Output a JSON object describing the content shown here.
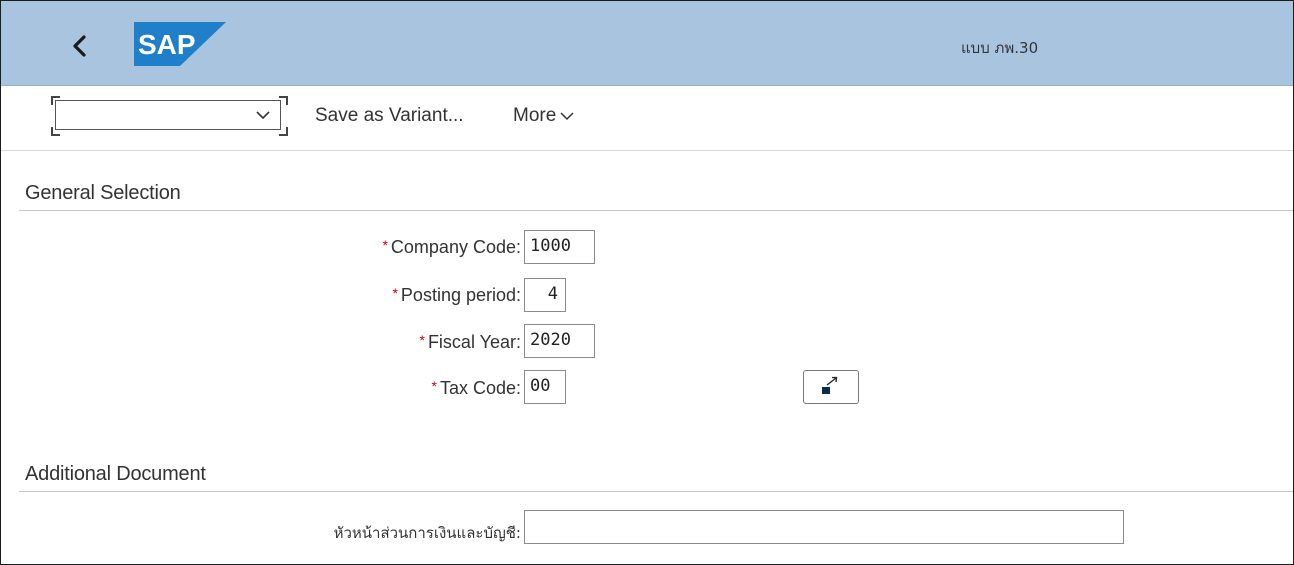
{
  "shell": {
    "title": "แบบ ภพ.30",
    "logo_text": "SAP",
    "back_icon": "chevron-left-icon",
    "colors": {
      "shellbar": "#a9c4df",
      "logo_blue": "#1f7fc9"
    }
  },
  "toolbar": {
    "variant_value": "",
    "save_variant_label": "Save as Variant...",
    "more_label": "More"
  },
  "general_selection": {
    "title": "General Selection",
    "fields": {
      "company_code": {
        "label": "Company Code:",
        "value": "1000",
        "required": "*"
      },
      "posting_period": {
        "label": "Posting period:",
        "value": "4",
        "required": "*"
      },
      "fiscal_year": {
        "label": "Fiscal Year:",
        "value": "2020",
        "required": "*"
      },
      "tax_code": {
        "label": "Tax Code:",
        "value": "00",
        "required": "*"
      }
    },
    "multiple_selection_icon": "multiple-selection-arrow-icon"
  },
  "additional_document": {
    "title": "Additional Document",
    "head_of_finance": {
      "label": "หัวหน้าส่วนการเงินและบัญชี:",
      "value": ""
    }
  }
}
